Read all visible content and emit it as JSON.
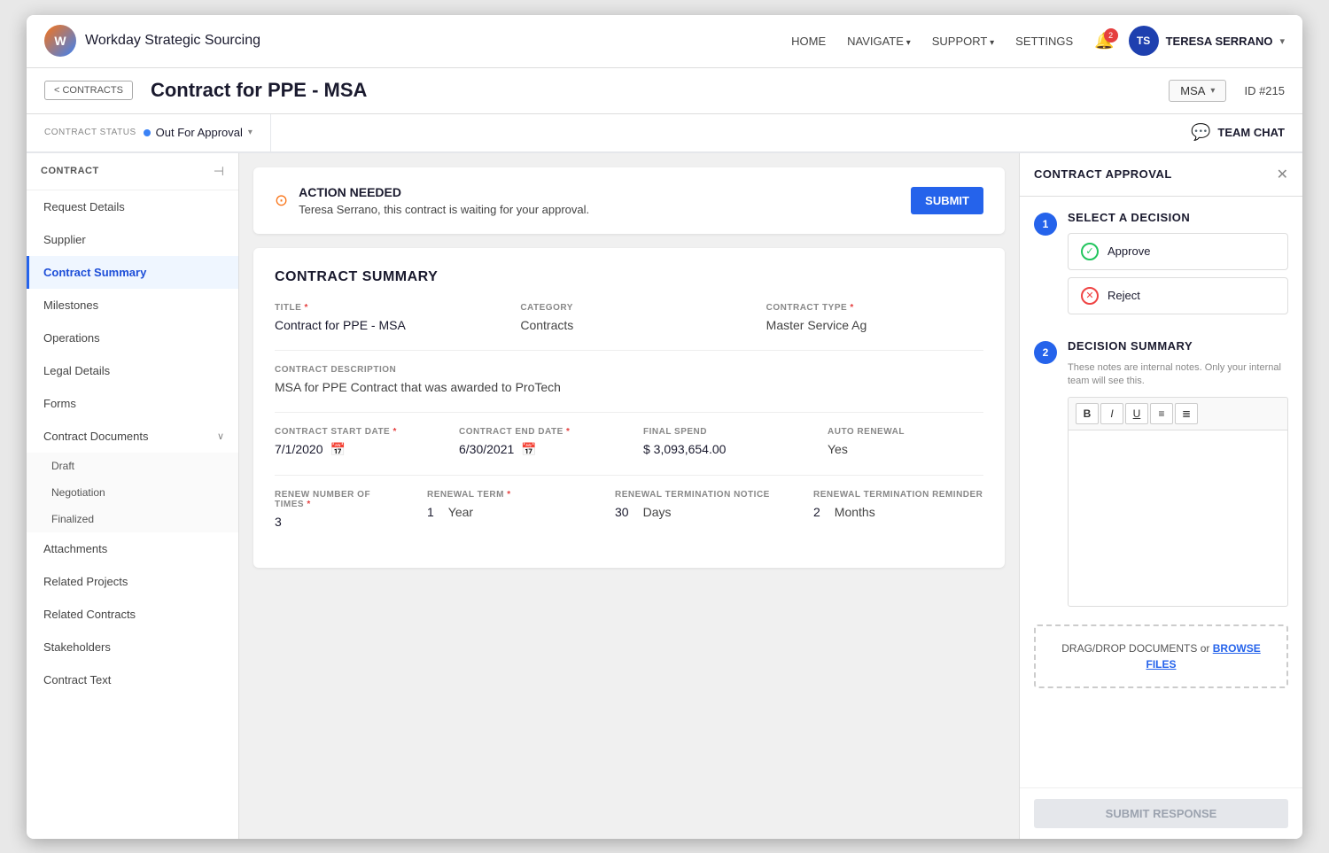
{
  "nav": {
    "logo_text": "W",
    "brand": "Workday Strategic Sourcing",
    "links": [
      {
        "label": "HOME",
        "arrow": false
      },
      {
        "label": "NAVIGATE",
        "arrow": true
      },
      {
        "label": "SUPPORT",
        "arrow": true
      },
      {
        "label": "SETTINGS",
        "arrow": false
      }
    ],
    "bell_count": "2",
    "user_initials": "TS",
    "username": "TERESA SERRANO",
    "username_arrow": "▾"
  },
  "subheader": {
    "back_label": "< CONTRACTS",
    "title": "Contract for PPE - MSA",
    "type_badge": "MSA",
    "contract_id": "ID #215"
  },
  "statusbar": {
    "contract_status_label": "CONTRACT STATUS",
    "status_value": "Out For Approval",
    "team_chat_label": "TEAM CHAT"
  },
  "sidebar": {
    "title": "CONTRACT",
    "toggle_icon": "⊣",
    "items": [
      {
        "label": "Request Details",
        "active": false,
        "has_submenu": false
      },
      {
        "label": "Supplier",
        "active": false,
        "has_submenu": false
      },
      {
        "label": "Contract Summary",
        "active": true,
        "has_submenu": false
      },
      {
        "label": "Milestones",
        "active": false,
        "has_submenu": false
      },
      {
        "label": "Operations",
        "active": false,
        "has_submenu": false
      },
      {
        "label": "Legal Details",
        "active": false,
        "has_submenu": false
      },
      {
        "label": "Forms",
        "active": false,
        "has_submenu": false
      },
      {
        "label": "Contract Documents",
        "active": false,
        "has_submenu": true,
        "subitems": [
          "Draft",
          "Negotiation",
          "Finalized"
        ]
      },
      {
        "label": "Attachments",
        "active": false,
        "has_submenu": false
      },
      {
        "label": "Related Projects",
        "active": false,
        "has_submenu": false
      },
      {
        "label": "Related Contracts",
        "active": false,
        "has_submenu": false
      },
      {
        "label": "Stakeholders",
        "active": false,
        "has_submenu": false
      },
      {
        "label": "Contract Text",
        "active": false,
        "has_submenu": false
      }
    ]
  },
  "action_banner": {
    "icon": "⊙",
    "title": "ACTION NEEDED",
    "text": "Teresa Serrano, this contract is waiting for your approval.",
    "submit_label": "SUBMIT"
  },
  "contract_summary": {
    "section_title": "CONTRACT SUMMARY",
    "title_label": "TITLE",
    "title_required": "*",
    "title_value": "Contract for PPE - MSA",
    "category_label": "CATEGORY",
    "category_value": "Contracts",
    "contract_type_label": "CONTRACT TYPE",
    "contract_type_required": "*",
    "contract_type_value": "Master Service Ag",
    "description_label": "CONTRACT DESCRIPTION",
    "description_value": "MSA for PPE Contract that was awarded to ProTech",
    "start_date_label": "CONTRACT START DATE",
    "start_date_required": "*",
    "start_date_value": "7/1/2020",
    "end_date_label": "CONTRACT END DATE",
    "end_date_required": "*",
    "end_date_value": "6/30/2021",
    "final_spend_label": "FINAL SPEND",
    "final_spend_value": "$ 3,093,654.00",
    "auto_renewal_label": "AUTO RENEWAL",
    "auto_renewal_value": "Yes",
    "renew_number_label": "RENEW NUMBER OF TIMES",
    "renew_number_required": "*",
    "renew_number_value": "3",
    "renewal_term_label": "RENEWAL TERM",
    "renewal_term_required": "*",
    "renewal_term_value": "1",
    "renewal_term_unit": "Year",
    "renewal_termination_label": "RENEWAL TERMINATION NOTICE",
    "renewal_termination_value": "30",
    "renewal_termination_unit": "Days",
    "renewal_termination_reminder_label": "RENEWAL TERMINATION REMINDER",
    "renewal_termination_reminder_value": "2",
    "renewal_termination_reminder_unit": "Months"
  },
  "right_panel": {
    "title": "CONTRACT APPROVAL",
    "close_icon": "✕",
    "step1": {
      "number": "1",
      "title": "SELECT A DECISION",
      "options": [
        {
          "label": "Approve",
          "type": "approve"
        },
        {
          "label": "Reject",
          "type": "reject"
        }
      ]
    },
    "step2": {
      "number": "2",
      "title": "DECISION SUMMARY",
      "subtitle": "These notes are internal notes. Only your internal team will see this.",
      "toolbar": [
        "B",
        "I",
        "U",
        "≡",
        "≣"
      ]
    },
    "drop_zone_text": "DRAG/DROP DOCUMENTS or ",
    "drop_zone_link": "BROWSE FILES",
    "submit_response_label": "SUBMIT RESPONSE"
  }
}
